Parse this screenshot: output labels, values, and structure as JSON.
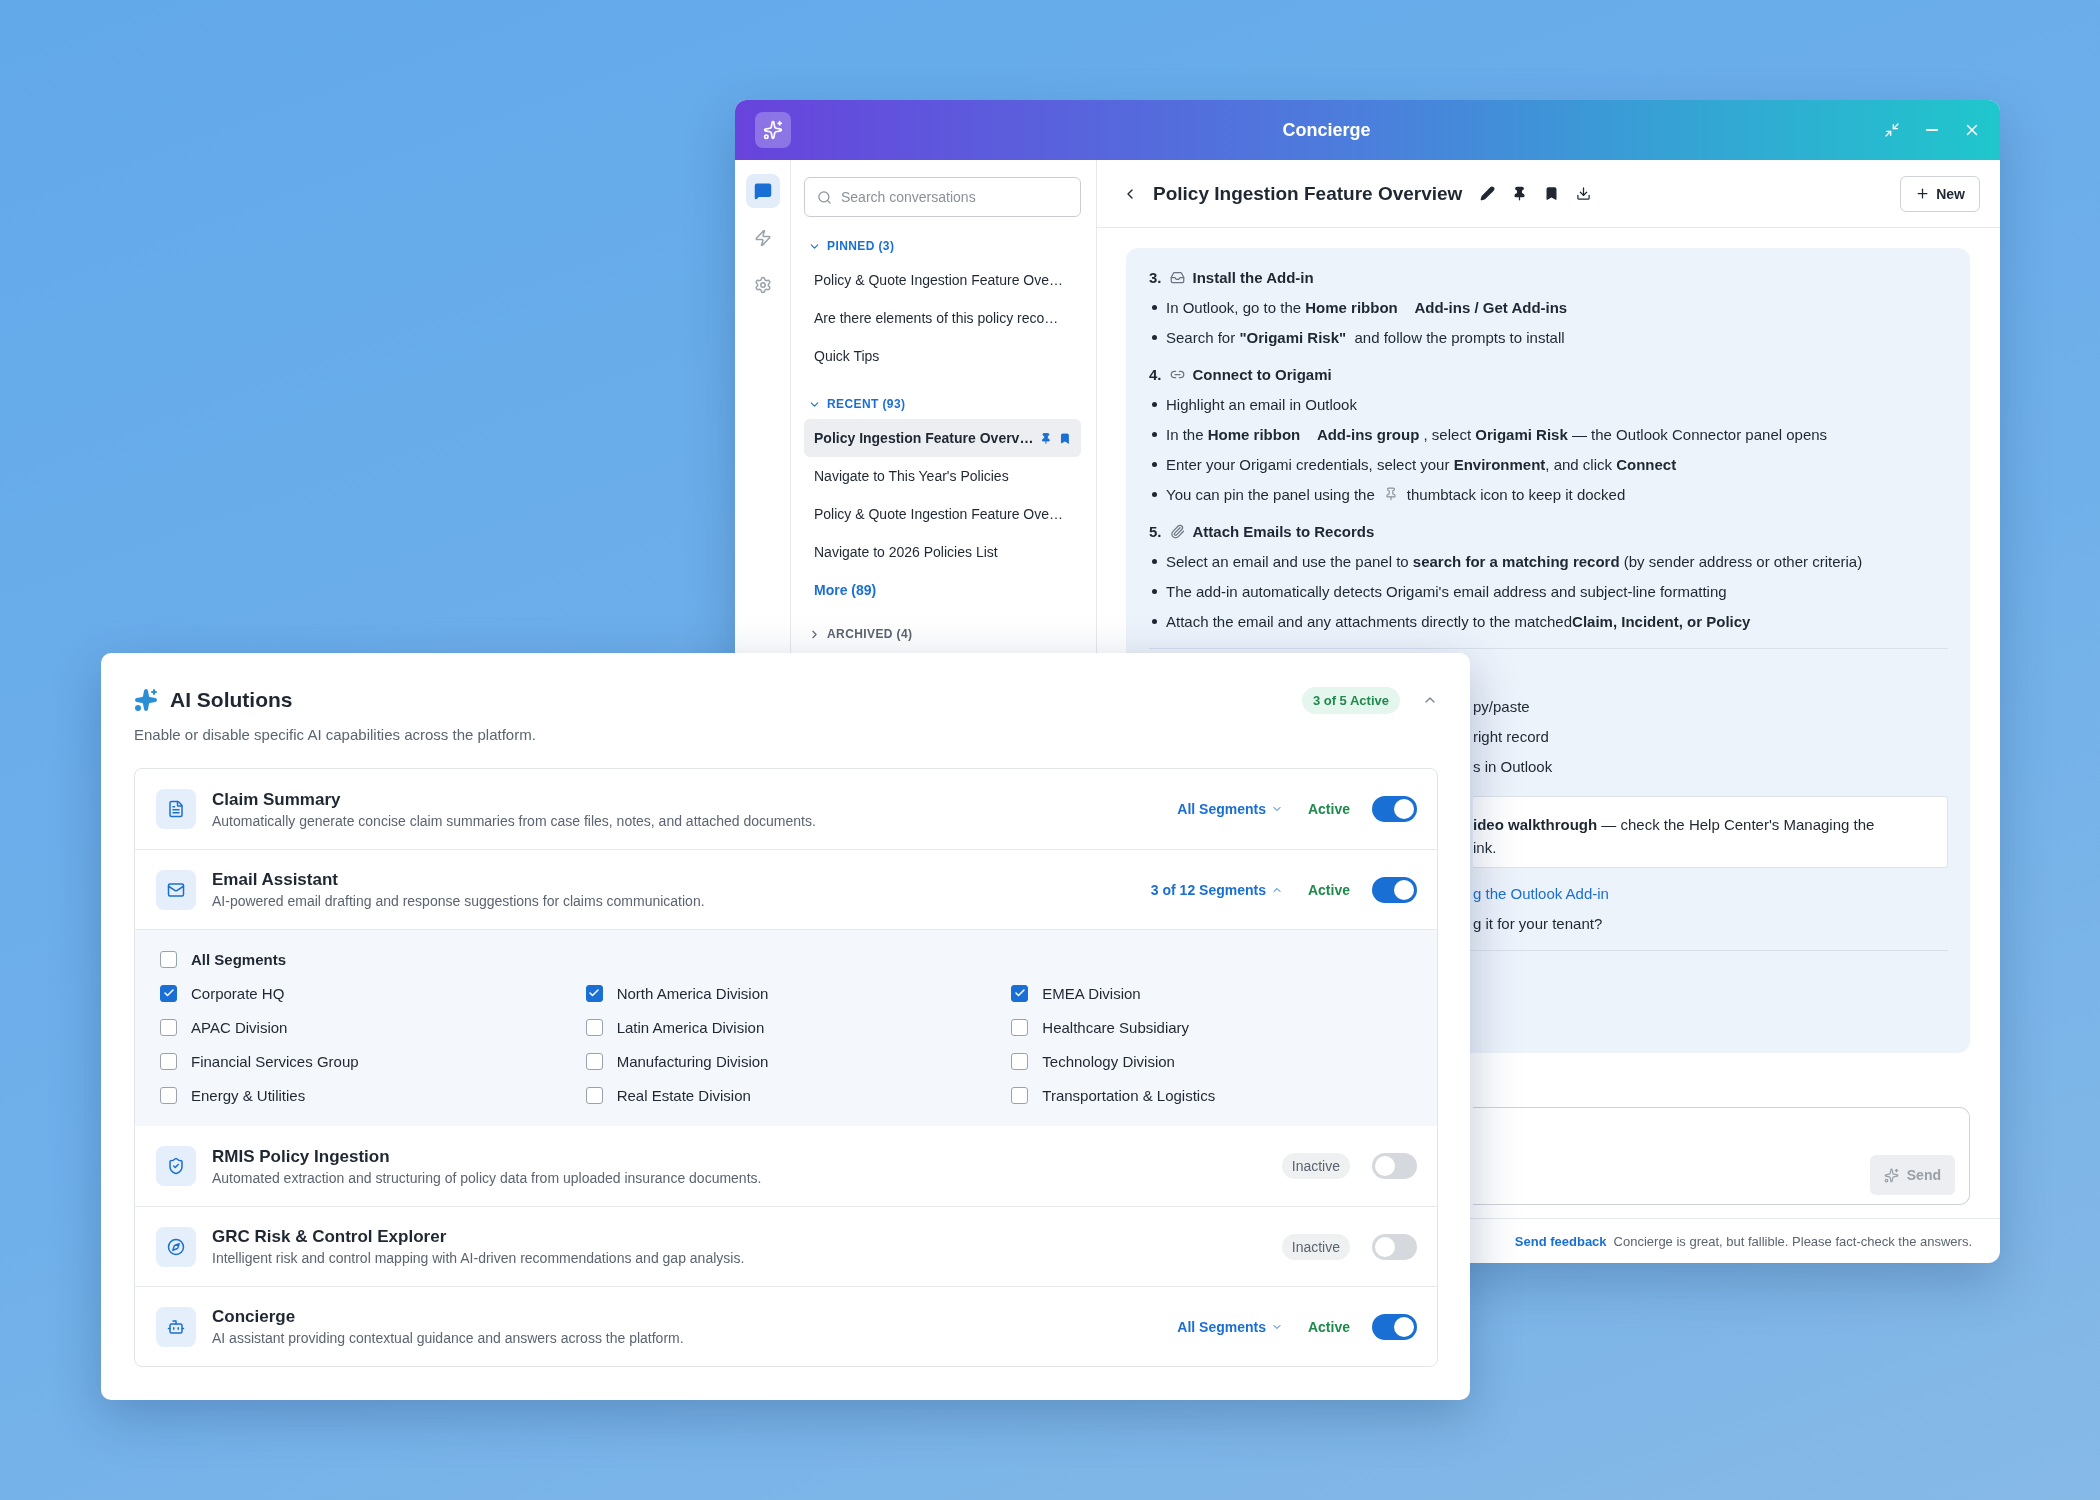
{
  "concierge": {
    "title": "Concierge",
    "rail": [
      {
        "selected": true
      },
      {
        "selected": false
      },
      {
        "selected": false
      }
    ],
    "search": {
      "placeholder": "Search conversations"
    },
    "sections": [
      {
        "label": "PINNED (3)",
        "expanded": true,
        "items": [
          {
            "title": "Policy & Quote Ingestion Feature Ove…",
            "selected": false,
            "pin_icon": false,
            "bookmark_icon": false
          },
          {
            "title": "Are there elements of this policy reco…",
            "selected": false,
            "pin_icon": false,
            "bookmark_icon": false
          },
          {
            "title": "Quick Tips",
            "selected": false,
            "pin_icon": false,
            "bookmark_icon": false
          }
        ]
      },
      {
        "label": "RECENT (93)",
        "expanded": true,
        "items": [
          {
            "title": "Policy Ingestion Feature Overv…",
            "selected": true,
            "pin_icon": true,
            "bookmark_icon": true
          },
          {
            "title": "Navigate to This Year's Policies",
            "selected": false,
            "pin_icon": false,
            "bookmark_icon": false
          },
          {
            "title": "Policy & Quote Ingestion Feature Ove…",
            "selected": false,
            "pin_icon": false,
            "bookmark_icon": false
          },
          {
            "title": "Navigate to 2026 Policies List",
            "selected": false,
            "pin_icon": false,
            "bookmark_icon": false
          }
        ],
        "more": "More (89)"
      },
      {
        "label": "ARCHIVED (4)",
        "expanded": false
      }
    ],
    "chat": {
      "title": "Policy Ingestion Feature Overview",
      "new_button": "New",
      "blocks": [
        {
          "kind": "heading",
          "number": "3.",
          "title": "Install the Add-in"
        },
        {
          "kind": "bullet",
          "text": "In Outlook, go to the **Home ribbon**    **Add-ins / Get Add-ins**"
        },
        {
          "kind": "bullet",
          "text": "Search for **\"Origami Risk\"**  and follow the prompts to install"
        },
        {
          "kind": "heading",
          "number": "4.",
          "title": "Connect to Origami"
        },
        {
          "kind": "bullet",
          "text": "Highlight an email in Outlook"
        },
        {
          "kind": "bullet",
          "text": "In the **Home ribbon**    **Add-ins group** , select **Origami Risk** — the Outlook Connector panel opens"
        },
        {
          "kind": "bullet",
          "text": "Enter your Origami credentials, select your **Environment**, and click **Connect**"
        },
        {
          "kind": "icon_bullet",
          "before": "You can pin the panel using the",
          "after": "thumbtack icon to keep it docked"
        },
        {
          "kind": "heading",
          "number": "5.",
          "title": "Attach Emails to Records"
        },
        {
          "kind": "bullet",
          "text": "Select an email and use the panel to **search for a matching record** (by sender address or other criteria)"
        },
        {
          "kind": "bullet",
          "text": "The add-in automatically detects Origami's email address and subject-line formatting"
        },
        {
          "kind": "bullet",
          "text": "Attach the email and any attachments directly to the matched**Claim, Incident, or Policy**"
        },
        {
          "kind": "divider"
        },
        {
          "kind": "partial",
          "text": "py/paste"
        },
        {
          "kind": "partial",
          "text": "right record"
        },
        {
          "kind": "partial",
          "text": "s in Outlook"
        },
        {
          "kind": "note",
          "lines": [
            "**ideo walkthrough** — check the Help Center's Managing the",
            "ink."
          ]
        },
        {
          "kind": "link",
          "text": "g the Outlook Add-in"
        },
        {
          "kind": "partial",
          "text": "g it for your tenant?"
        },
        {
          "kind": "divider"
        }
      ],
      "send_button": "Send",
      "feedback_link": "Send feedback",
      "disclaimer": "Concierge is great, but fallible. Please fact-check the answers."
    }
  },
  "ai_solutions": {
    "title": "AI Solutions",
    "badge": "3 of 5 Active",
    "expanded": true,
    "subtitle": "Enable or disable specific AI capabilities across the platform.",
    "features": [
      {
        "name": "Claim Summary",
        "description": "Automatically generate concise claim summaries from case files, notes, and attached documents.",
        "segments": {
          "label": "All Segments",
          "expanded": false
        },
        "status": "Active",
        "on": true
      },
      {
        "name": "Email Assistant",
        "description": "AI-powered email drafting and response suggestions for claims communication.",
        "segments": {
          "label": "3 of 12 Segments",
          "expanded": true
        },
        "status": "Active",
        "on": true,
        "segment_options": {
          "all": {
            "label": "All Segments",
            "checked": false
          },
          "items": [
            {
              "label": "Corporate HQ",
              "checked": true
            },
            {
              "label": "North America Division",
              "checked": true
            },
            {
              "label": "EMEA Division",
              "checked": true
            },
            {
              "label": "APAC Division",
              "checked": false
            },
            {
              "label": "Latin America Division",
              "checked": false
            },
            {
              "label": "Healthcare Subsidiary",
              "checked": false
            },
            {
              "label": "Financial Services Group",
              "checked": false
            },
            {
              "label": "Manufacturing Division",
              "checked": false
            },
            {
              "label": "Technology Division",
              "checked": false
            },
            {
              "label": "Energy & Utilities",
              "checked": false
            },
            {
              "label": "Real Estate Division",
              "checked": false
            },
            {
              "label": "Transportation & Logistics",
              "checked": false
            }
          ]
        }
      },
      {
        "name": "RMIS Policy Ingestion",
        "description": "Automated extraction and structuring of policy data from uploaded insurance documents.",
        "status": "Inactive",
        "on": false
      },
      {
        "name": "GRC Risk & Control Explorer",
        "description": "Intelligent risk and control mapping with AI-driven recommendations and gap analysis.",
        "status": "Inactive",
        "on": false
      },
      {
        "name": "Concierge",
        "description": "AI assistant providing contextual guidance and answers across the platform.",
        "segments": {
          "label": "All Segments",
          "expanded": false
        },
        "status": "Active",
        "on": true
      }
    ]
  }
}
